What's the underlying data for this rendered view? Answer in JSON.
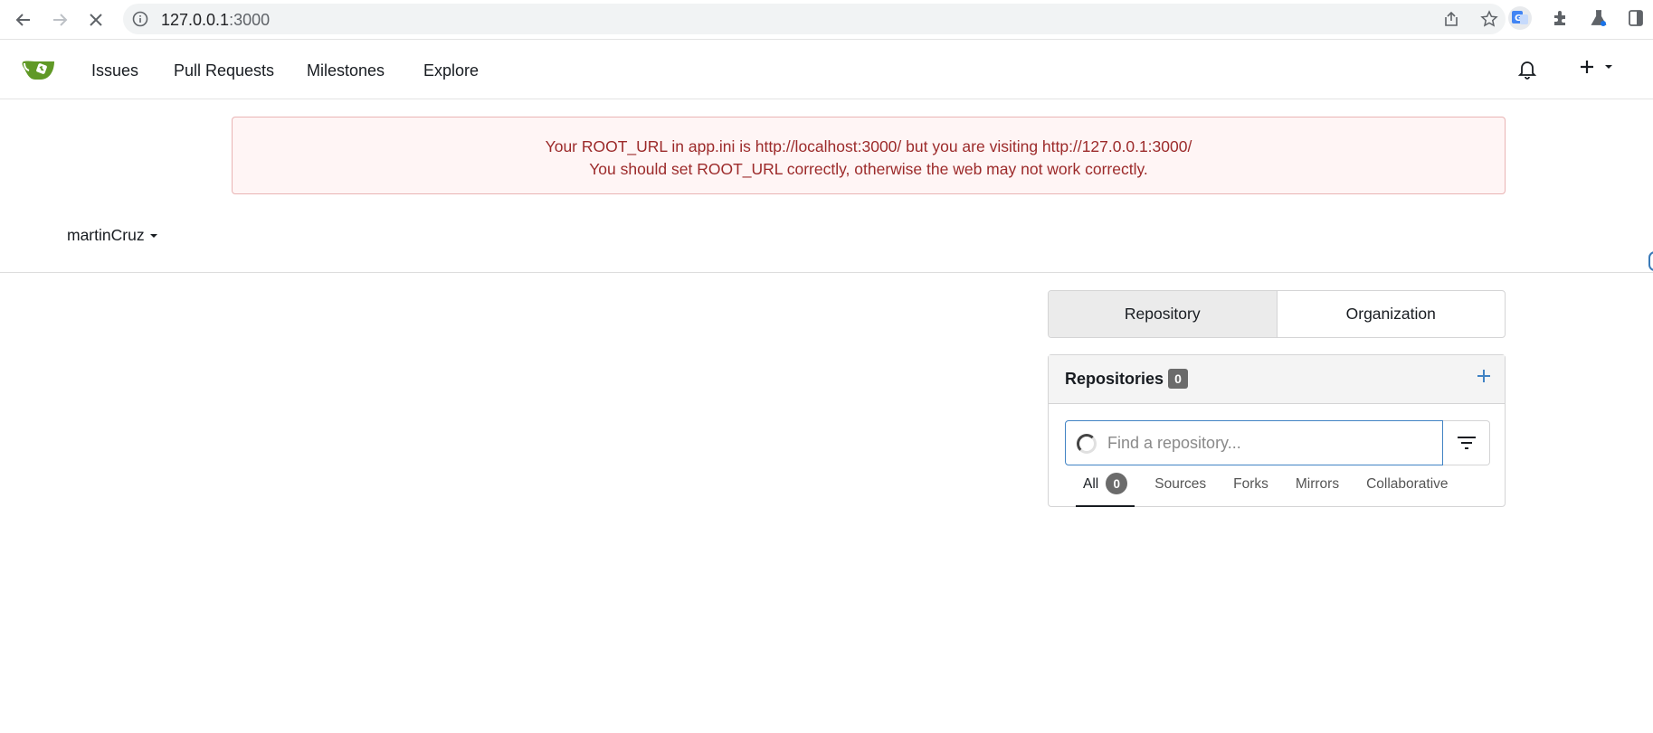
{
  "browser": {
    "url_host": "127.0.0.1",
    "url_port": ":3000",
    "loading": true
  },
  "navbar": {
    "links": [
      "Issues",
      "Pull Requests",
      "Milestones",
      "Explore"
    ]
  },
  "alert": {
    "line1": "Your ROOT_URL in app.ini is http://localhost:3000/ but you are visiting http://127.0.0.1:3000/",
    "line2": "You should set ROOT_URL correctly, otherwise the web may not work correctly."
  },
  "context_user": {
    "name": "martinCruz"
  },
  "panel": {
    "tabs": [
      "Repository",
      "Organization"
    ],
    "active_tab": "Repository",
    "repositories": {
      "title": "Repositories",
      "count": "0",
      "search_placeholder": "Find a repository...",
      "sub_tabs": [
        {
          "label": "All",
          "count": "0"
        },
        {
          "label": "Sources"
        },
        {
          "label": "Forks"
        },
        {
          "label": "Mirrors"
        },
        {
          "label": "Collaborative"
        }
      ]
    }
  },
  "colors": {
    "alert_bg": "#fff5f5",
    "alert_text": "#9c2a2a",
    "link_blue": "#4183c4",
    "logo_green": "#609926"
  }
}
